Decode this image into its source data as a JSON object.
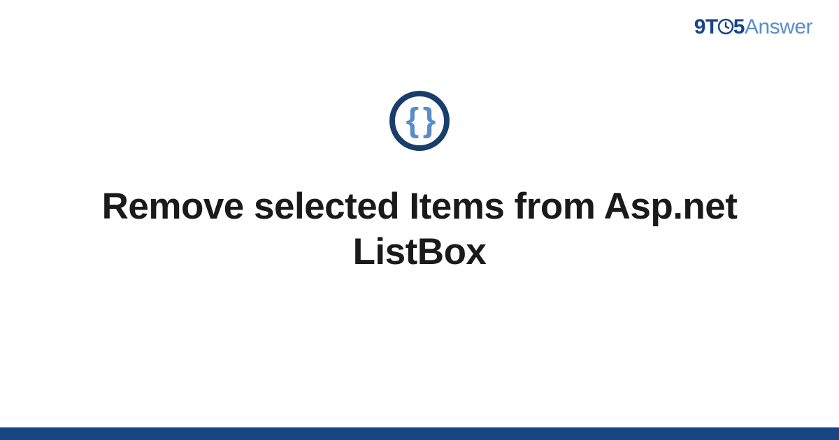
{
  "logo": {
    "part1": "9T",
    "part2": "5",
    "part3": "Answer"
  },
  "icon": {
    "glyph": "{ }"
  },
  "title": "Remove selected Items from Asp.net ListBox",
  "colors": {
    "brand_dark": "#174685",
    "brand_light": "#5a8cc9",
    "ring": "#183e6b"
  }
}
